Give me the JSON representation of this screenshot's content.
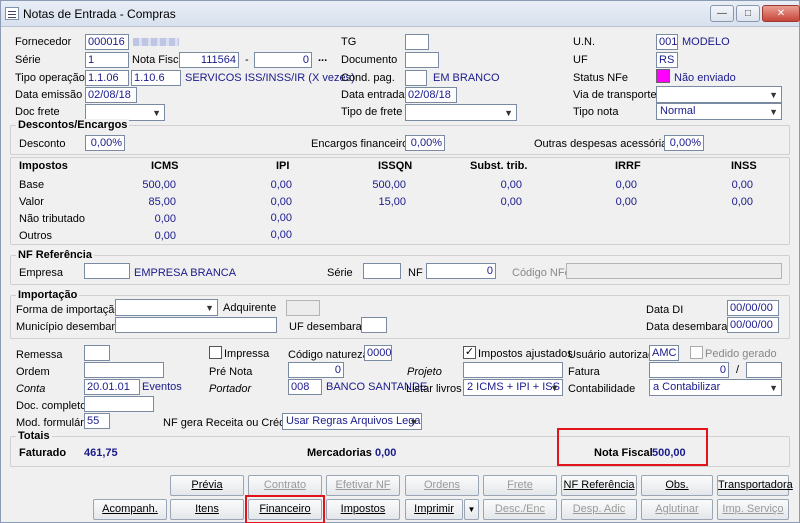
{
  "window": {
    "title": "Notas de Entrada - Compras",
    "controls": [
      "—",
      "□",
      "✕"
    ]
  },
  "header": {
    "fornecedor_label": "Fornecedor",
    "fornecedor_value": "000016",
    "serie_label": "Série",
    "serie_value": "1",
    "nota_fiscal_label": "Nota Fiscal",
    "nota_fiscal_value": "111564",
    "nota_fiscal_dash": "-",
    "nota_fiscal_seq": "0",
    "nota_fiscal_more": "...",
    "tipo_operacao_label": "Tipo operação",
    "tipo_operacao_code": "1.1.06",
    "tipo_operacao_code2": "1.10.6",
    "tipo_operacao_desc": "SERVICOS ISS/INSS/IR (X vezes)",
    "data_emissao_label": "Data emissão",
    "data_emissao_value": "02/08/18",
    "doc_frete_label": "Doc frete",
    "tg_label": "TG",
    "documento_label": "Documento",
    "cond_pag_label": "Cond. pag.",
    "cond_pag_desc": "EM BRANCO",
    "data_entrada_label": "Data entrada",
    "data_entrada_value": "02/08/18",
    "tipo_frete_label": "Tipo de frete",
    "un_label": "U.N.",
    "un_value": "001",
    "un_desc": "MODELO",
    "uf_label": "UF",
    "uf_value": "RS",
    "status_nfe_label": "Status NFe",
    "status_nfe_value": "Não enviado",
    "via_transporte_label": "Via de transporte",
    "tipo_nota_label": "Tipo nota",
    "tipo_nota_value": "Normal"
  },
  "descontos": {
    "title": "Descontos/Encargos",
    "desconto_label": "Desconto",
    "desconto_value": "0,00%",
    "encargos_label": "Encargos financeiros",
    "encargos_value": "0,00%",
    "outras_label": "Outras despesas acessórias",
    "outras_value": "0,00%"
  },
  "impostos": {
    "title": "Impostos",
    "columns": [
      "ICMS",
      "IPI",
      "ISSQN",
      "Subst. trib.",
      "IRRF",
      "INSS"
    ],
    "rows": [
      {
        "label": "Base",
        "values": [
          "500,00",
          "0,00",
          "500,00",
          "0,00",
          "0,00",
          "0,00"
        ]
      },
      {
        "label": "Valor",
        "values": [
          "85,00",
          "0,00",
          "15,00",
          "0,00",
          "0,00",
          "0,00"
        ]
      },
      {
        "label": "Não tributado",
        "values": [
          "0,00",
          "0,00"
        ]
      },
      {
        "label": "Outros",
        "values": [
          "0,00",
          "0,00"
        ]
      }
    ]
  },
  "nf_referencia": {
    "title": "NF Referência",
    "empresa_label": "Empresa",
    "empresa_desc": "EMPRESA BRANCA",
    "serie_label": "Série",
    "nf_label": "NF",
    "nf_value": "0",
    "codigo_nfe_label": "Código NFe"
  },
  "importacao": {
    "title": "Importação",
    "forma_label": "Forma de importação",
    "adquirente_label": "Adquirente",
    "data_di_label": "Data DI",
    "data_di_value": "00/00/00",
    "municipio_label": "Município desembaraço",
    "uf_desembaraco_label": "UF desembaraço",
    "data_desembaraco_label": "Data desembaraço",
    "data_desembaraco_value": "00/00/00"
  },
  "misc": {
    "remessa_label": "Remessa",
    "impressa_label": "Impressa",
    "codigo_natureza_label": "Código natureza",
    "codigo_natureza_value": "0000",
    "impostos_ajustados_label": "Impostos ajustados",
    "usuario_autorizado_label": "Usuário autorizado",
    "usuario_autorizado_value": "AMC",
    "pedido_gerado_label": "Pedido gerado",
    "ordem_label": "Ordem",
    "pre_nota_label": "Pré Nota",
    "pre_nota_value": "0",
    "projeto_label": "Projeto",
    "fatura_label": "Fatura",
    "fatura_value": "0",
    "fatura_slash": "/",
    "conta_label": "Conta",
    "conta_value": "20.01.01",
    "conta_desc": "Eventos",
    "portador_label": "Portador",
    "portador_value": "008",
    "portador_desc": "BANCO SANTANDE",
    "listar_livros_label": "Listar livros",
    "listar_livros_value": "2 ICMS + IPI + ISS",
    "contabilidade_label": "Contabilidade",
    "contabilidade_value": "a Contabilizar",
    "doc_completo_label": "Doc. completo",
    "mod_formulario_label": "Mod. formulário",
    "mod_formulario_value": "55",
    "nf_gera_label": "NF gera Receita ou Crédito",
    "nf_gera_value": "Usar Regras Arquivos Legais"
  },
  "totais": {
    "title": "Totais",
    "faturado_label": "Faturado",
    "faturado_value": "461,75",
    "mercadorias_label": "Mercadorias",
    "mercadorias_value": "0,00",
    "nota_fiscal_label": "Nota Fiscal",
    "nota_fiscal_value": "500,00"
  },
  "buttons": {
    "previa": "Prévia",
    "contrato": "Contrato",
    "efetivar_nf": "Efetivar NF",
    "ordens": "Ordens",
    "frete": "Frete",
    "nf_referencia": "NF Referência",
    "obs": "Obs.",
    "transportadora": "Transportadora",
    "acompanh": "Acompanh.",
    "itens": "Itens",
    "financeiro": "Financeiro",
    "impostos": "Impostos",
    "imprimir": "Imprimir",
    "desc_enc": "Desc./Enc",
    "desp_adic": "Desp. Adic",
    "aglutinar": "Aglutinar",
    "imp_servico": "Imp. Serviço"
  },
  "colors": {
    "accent_red": "#e0141a",
    "status_magenta": "#ff00ff",
    "value_blue": "#1a1a8c"
  }
}
